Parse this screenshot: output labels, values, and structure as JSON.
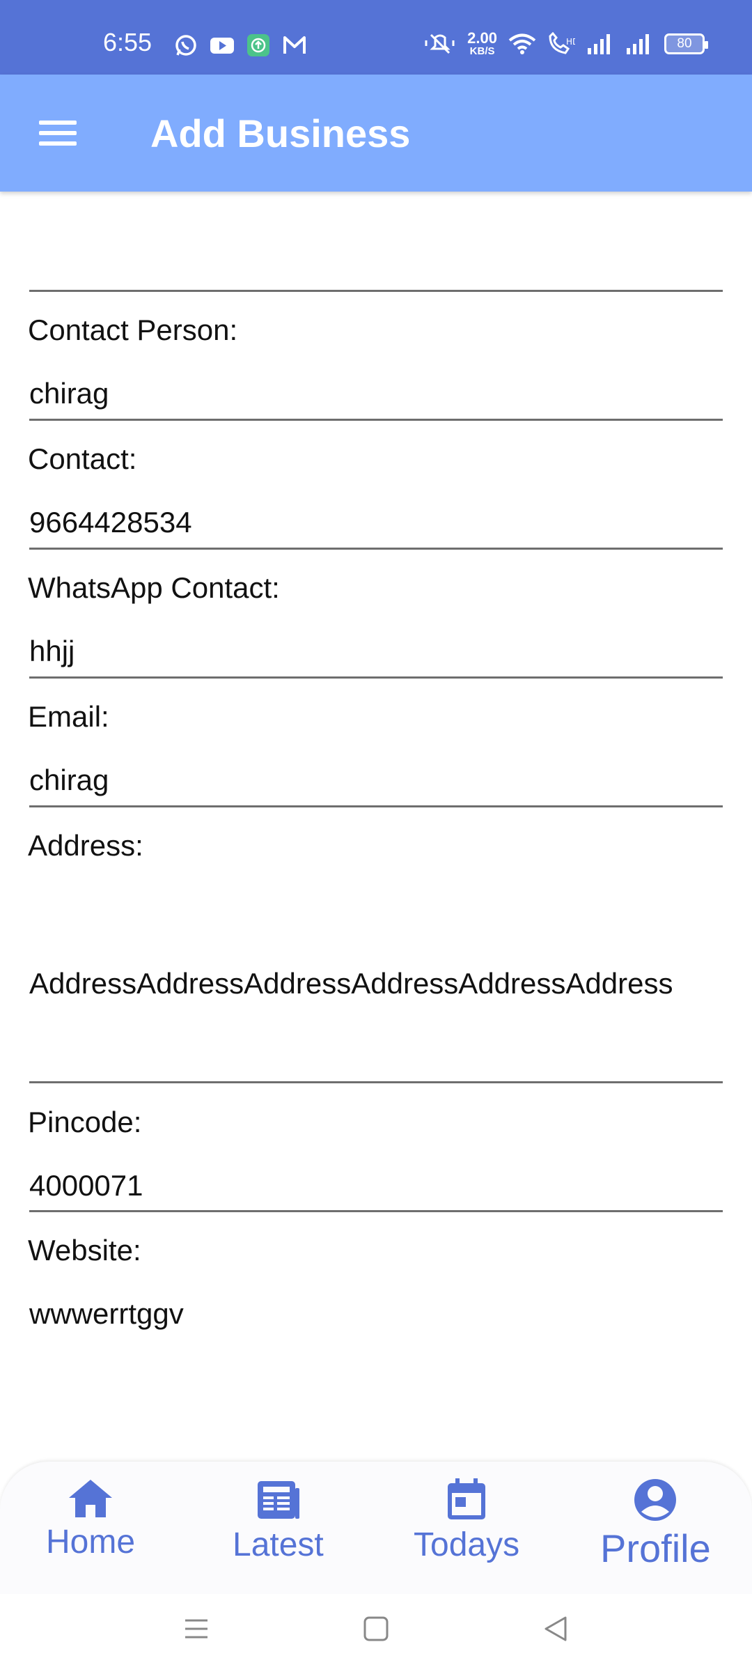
{
  "status_bar": {
    "time": "6:55",
    "net_speed_value": "2.00",
    "net_speed_unit": "KB/S",
    "battery": "80",
    "app_icons": [
      "whatsapp-icon",
      "youtube-icon",
      "upload-app-icon",
      "gmail-icon"
    ],
    "status_icons": [
      "mute-icon",
      "wifi-icon",
      "volte-call-icon",
      "signal-icon",
      "signal-icon"
    ]
  },
  "app_bar": {
    "title": "Add Business",
    "menu_icon": "hamburger-menu-icon",
    "background": "#80acfe"
  },
  "form": {
    "fields": [
      {
        "label": "Contact Person:",
        "value": "chirag"
      },
      {
        "label": "Contact:",
        "value": "9664428534"
      },
      {
        "label": "WhatsApp Contact:",
        "value": "hhjj"
      },
      {
        "label": "Email:",
        "value": "chirag"
      },
      {
        "label": "Address:",
        "value": "AddressAddressAddressAddressAddressAddress"
      },
      {
        "label": "Pincode:",
        "value": "4000071"
      },
      {
        "label": "Website:",
        "value": "wwwerrtggv"
      }
    ]
  },
  "bottom_nav": {
    "items": [
      {
        "label": "Home",
        "icon": "home-icon"
      },
      {
        "label": "Latest",
        "icon": "newspaper-icon"
      },
      {
        "label": "Todays",
        "icon": "calendar-icon"
      },
      {
        "label": "Profile",
        "icon": "account-circle-icon"
      }
    ],
    "accent": "#5573d6"
  },
  "system_nav": {
    "icons": [
      "recents-icon",
      "home-square-icon",
      "back-icon"
    ]
  }
}
